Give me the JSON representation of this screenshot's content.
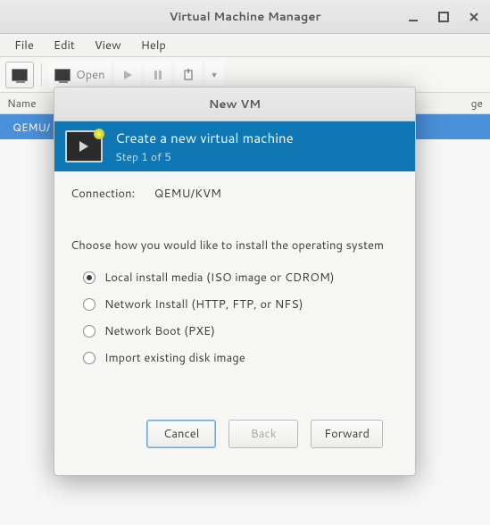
{
  "window": {
    "title": "Virtual Machine Manager"
  },
  "menubar": {
    "file": "File",
    "edit": "Edit",
    "view": "View",
    "help": "Help"
  },
  "toolbar": {
    "open_label": "Open"
  },
  "columns": {
    "name": "Name",
    "usage": "ge"
  },
  "rows": {
    "first": "QEMU/"
  },
  "dialog": {
    "title": "New VM",
    "hero_title": "Create a new virtual machine",
    "hero_step": "Step 1 of 5",
    "connection_label": "Connection:",
    "connection_value": "QEMU/KVM",
    "prompt": "Choose how you would like to install the operating system",
    "options": {
      "o1": "Local install media (ISO image or CDROM)",
      "o2": "Network Install (HTTP, FTP, or NFS)",
      "o3": "Network Boot (PXE)",
      "o4": "Import existing disk image"
    },
    "buttons": {
      "cancel": "Cancel",
      "back": "Back",
      "forward": "Forward"
    }
  }
}
